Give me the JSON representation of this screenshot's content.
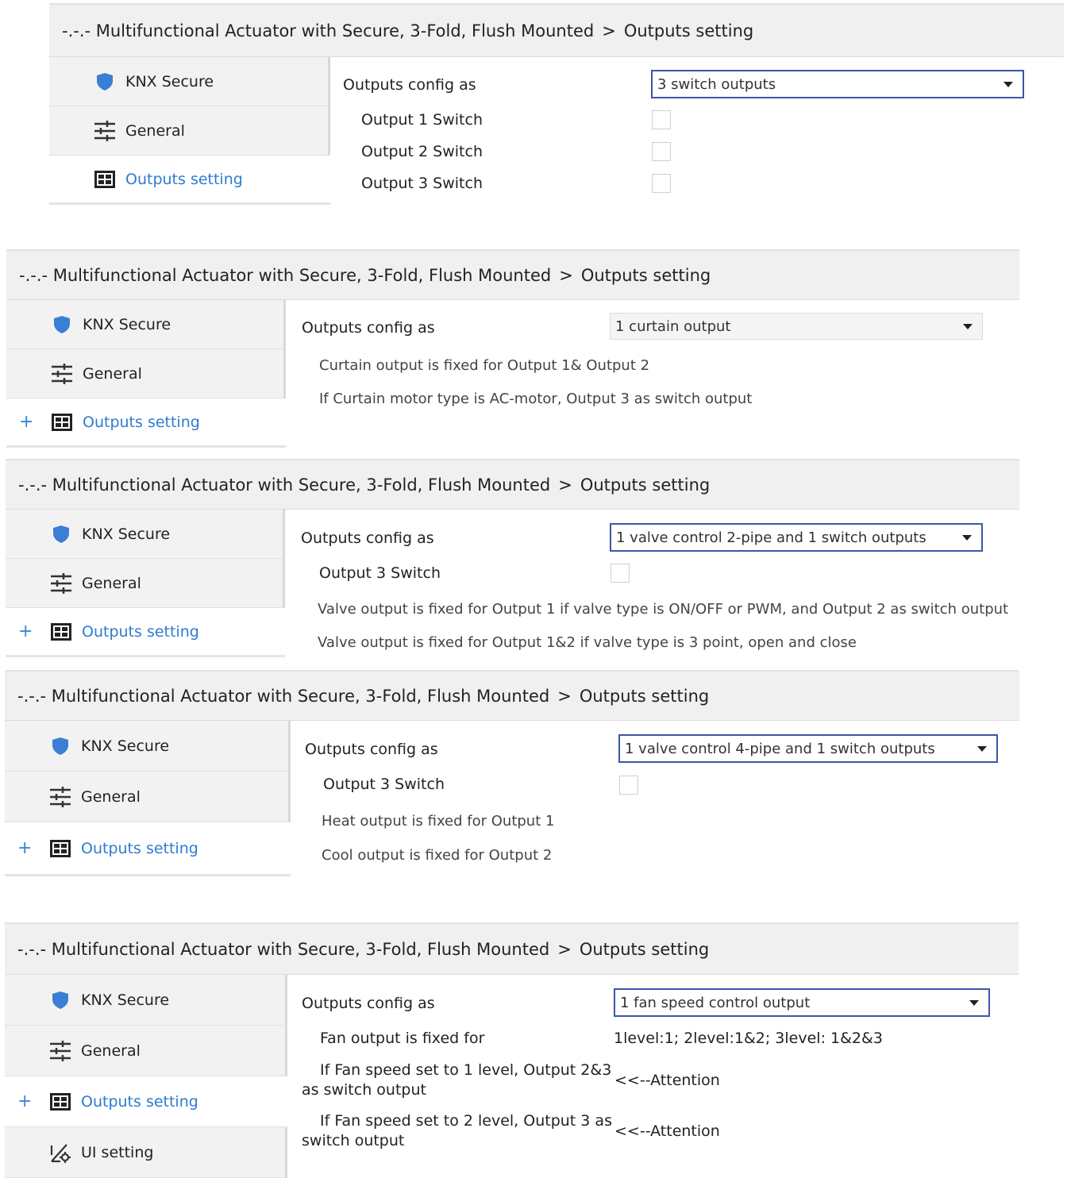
{
  "header": {
    "device": "-.-.- Multifunctional Actuator with Secure, 3-Fold, Flush Mounted",
    "separator": ">",
    "page": "Outputs setting"
  },
  "nav": {
    "knx_secure": "KNX Secure",
    "general": "General",
    "outputs_setting": "Outputs setting",
    "ui_setting": "UI setting",
    "plus": "+"
  },
  "labels": {
    "outputs_config_as": "Outputs config as",
    "output1_switch": "Output 1 Switch",
    "output2_switch": "Output 2 Switch",
    "output3_switch": "Output 3 Switch"
  },
  "panel1": {
    "config_value": "3 switch outputs"
  },
  "panel2": {
    "config_value": "1 curtain output",
    "note1": "Curtain output is fixed for Output 1& Output 2",
    "note2": "If Curtain motor type is AC-motor, Output 3 as switch output"
  },
  "panel3": {
    "config_value": "1 valve control 2-pipe and 1 switch outputs",
    "note1": "Valve output is fixed for Output 1 if  valve type is ON/OFF or PWM, and Output 2 as switch output",
    "note2": "Valve output is fixed for Output 1&2 if  valve type is 3 point, open and close"
  },
  "panel4": {
    "config_value": "1 valve control 4-pipe and 1 switch outputs",
    "note1": "Heat output is fixed for Output 1",
    "note2": "Cool output is fixed for Output 2"
  },
  "panel5": {
    "config_value": "1 fan speed control output",
    "fan_fixed_label": "Fan output is fixed for",
    "fan_fixed_value": "1level:1; 2level:1&2; 3level: 1&2&3",
    "level1_text": "If Fan speed set to 1 level, Output 2&3 as switch output",
    "level2_text": "If Fan speed set to 2 level, Output 3 as switch output",
    "attention": "<<--Attention"
  },
  "colors": {
    "accent": "#2d7bd0",
    "border": "#3b57a8",
    "shield": "#3a7fd5"
  },
  "icons": {
    "shield": "shield-icon",
    "sliders": "sliders-icon",
    "grid": "grid-icon",
    "ui": "ui-setting-icon"
  }
}
